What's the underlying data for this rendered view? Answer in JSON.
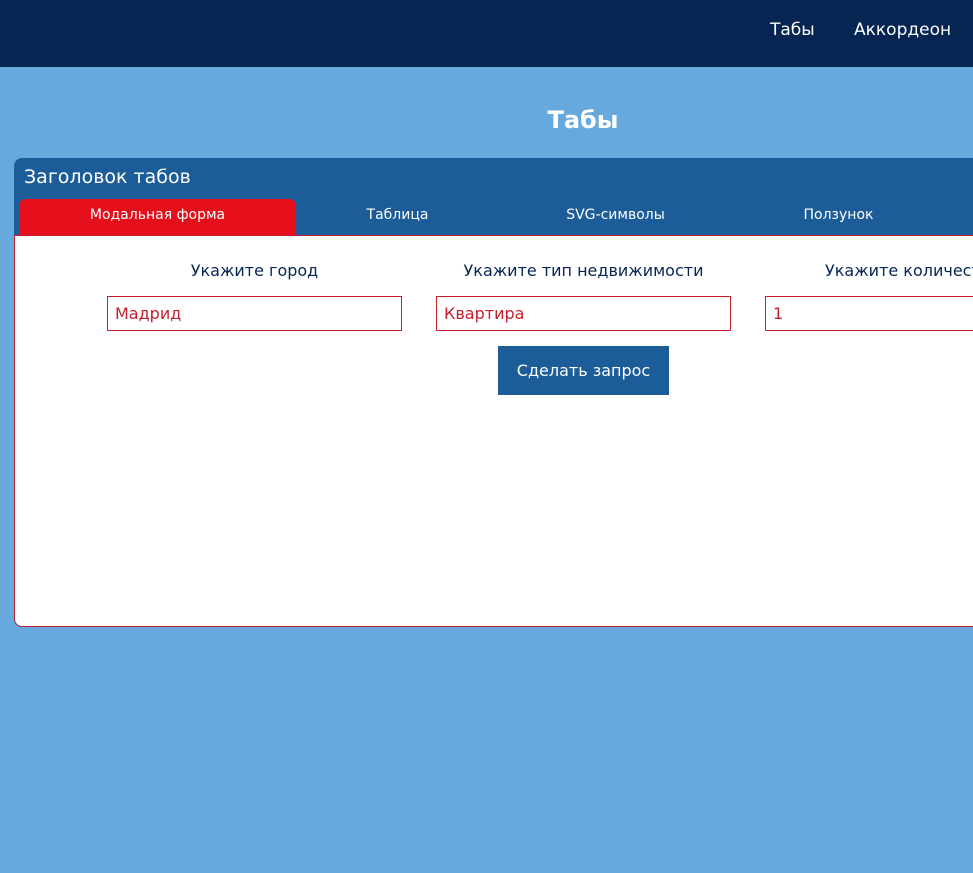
{
  "nav": {
    "items": [
      {
        "label": "Табы"
      },
      {
        "label": "Аккордеон"
      }
    ]
  },
  "page": {
    "title": "Табы"
  },
  "tabs_panel": {
    "heading": "Заголовок табов",
    "tabs": [
      {
        "label": "Модальная форма",
        "active": true
      },
      {
        "label": "Таблица",
        "active": false
      },
      {
        "label": "SVG-символы",
        "active": false
      },
      {
        "label": "Ползунок",
        "active": false
      }
    ]
  },
  "form": {
    "city": {
      "label": "Укажите город",
      "value": "Мадрид"
    },
    "property_type": {
      "label": "Укажите тип недвижимости",
      "value": "Квартира"
    },
    "quantity": {
      "label": "Укажите количество",
      "value": "1"
    },
    "submit_label": "Сделать запрос"
  },
  "colors": {
    "header_bg": "#072553",
    "page_bg": "#67a9dd",
    "panel_bg": "#1c5c98",
    "active_tab": "#e40f1a",
    "accent_red": "#c3202b"
  }
}
